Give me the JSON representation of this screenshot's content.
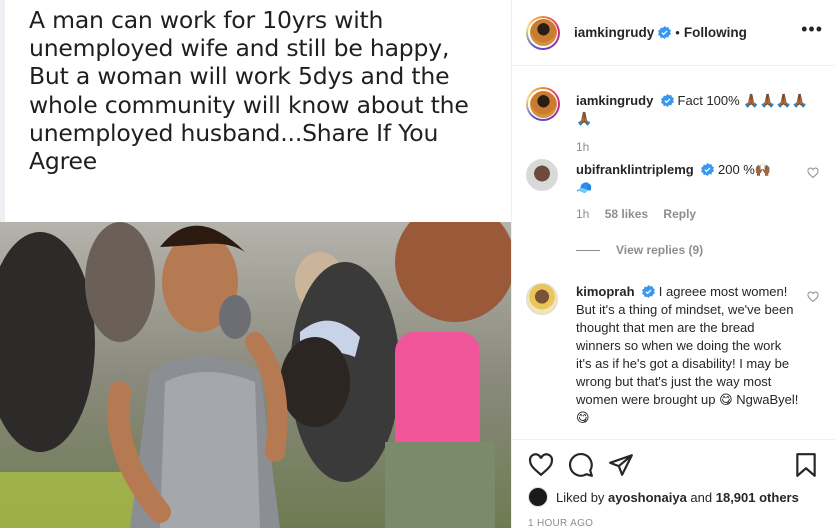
{
  "post": {
    "caption_image_text": "A man can work for 10yrs with\nunemployed wife and still be happy,\nBut a woman will work 5dys and the\nwhole community will know about the\nunemployed husband...Share If You\nAgree"
  },
  "header": {
    "username": "iamkingrudy",
    "separator": "•",
    "follow_status": "Following",
    "more_label": "•••"
  },
  "caption_comment": {
    "username": "iamkingrudy",
    "text": "Fact 100% 🙏🏾🙏🏾🙏🏾🙏🏾🙏🏾",
    "time": "1h"
  },
  "comments": [
    {
      "username": "ubifranklintriplemg",
      "text": "200 %🙌🏾",
      "text2": "🧢",
      "time": "1h",
      "likes": "58 likes",
      "reply": "Reply",
      "view_replies": "View replies (9)"
    },
    {
      "username": "kimoprah",
      "text": "I agreee most women! But it's a thing of mindset, we've been thought that men are the bread winners so when we doing the work it's as if he's got a disability! I may be wrong but that's just the way most women were brought up 😋 NgwaByel!😋"
    }
  ],
  "likes": {
    "prefix": "Liked by ",
    "user": "ayoshonaiya",
    "middle": " and ",
    "others": "18,901 others"
  },
  "timestamp": "1 HOUR AGO",
  "colors": {
    "verified": "#3897f0",
    "text": "#262626",
    "meta": "#8e8e8e"
  }
}
